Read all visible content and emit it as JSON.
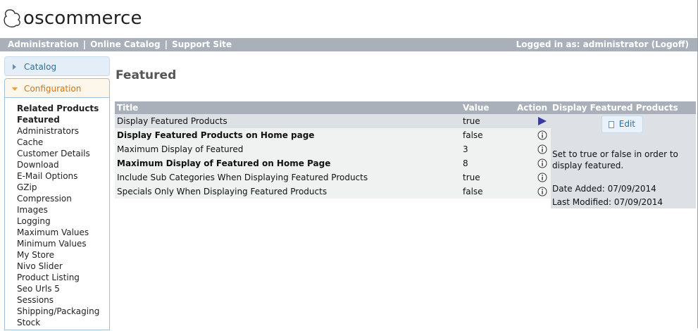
{
  "logo": {
    "text": "oscommerce"
  },
  "header": {
    "links": [
      "Administration",
      "Online Catalog",
      "Support Site"
    ],
    "separator": "|",
    "user_status": "Logged in as: administrator (Logoff)"
  },
  "sidebar": {
    "sections": [
      {
        "label": "Catalog",
        "expanded": false
      },
      {
        "label": "Configuration",
        "expanded": true
      }
    ],
    "items": [
      {
        "label": "Related Products",
        "bold": true
      },
      {
        "label": "Featured",
        "bold": true
      },
      {
        "label": "Administrators"
      },
      {
        "label": "Cache"
      },
      {
        "label": "Customer Details"
      },
      {
        "label": "Download"
      },
      {
        "label": "E-Mail Options"
      },
      {
        "label": "GZip"
      },
      {
        "label": "Compression"
      },
      {
        "label": "Images"
      },
      {
        "label": "Logging"
      },
      {
        "label": "Maximum Values"
      },
      {
        "label": "Minimum Values"
      },
      {
        "label": "My Store"
      },
      {
        "label": "Nivo Slider"
      },
      {
        "label": "Product Listing"
      },
      {
        "label": "Seo Urls 5"
      },
      {
        "label": "Sessions"
      },
      {
        "label": "Shipping/Packaging"
      },
      {
        "label": "Stock"
      }
    ]
  },
  "page_title": "Featured",
  "table": {
    "headers": {
      "title": "Title",
      "value": "Value",
      "action": "Action"
    },
    "rows": [
      {
        "title": "Display Featured Products",
        "value": "true",
        "action_icon": "selected-arrow-icon",
        "selected": true
      },
      {
        "title": "Display Featured Products on Home page",
        "value": "false",
        "action_icon": "info-icon",
        "bold": true
      },
      {
        "title": "Maximum Display of Featured",
        "value": "3",
        "action_icon": "info-icon"
      },
      {
        "title": "Maximum Display of Featured on Home Page",
        "value": "8",
        "action_icon": "info-icon",
        "bold": true
      },
      {
        "title": "Include Sub Categories When Displaying Featured Products",
        "value": "true",
        "action_icon": "info-icon"
      },
      {
        "title": "Specials Only When Displaying Featured Products",
        "value": "false",
        "action_icon": "info-icon"
      }
    ]
  },
  "info_panel": {
    "heading": "Display Featured Products",
    "edit_label": "Edit",
    "description": "Set to true or false in order to display featured.",
    "date_added": "Date Added: 07/09/2014",
    "last_modified": "Last Modified: 07/09/2014"
  },
  "colors": {
    "header_bar": "#aab0ba",
    "accordion_blue": "#2e6e9e",
    "accordion_active": "#e17009",
    "selected_row": "#dde0e5",
    "action_icon": "#3a3aa0"
  }
}
